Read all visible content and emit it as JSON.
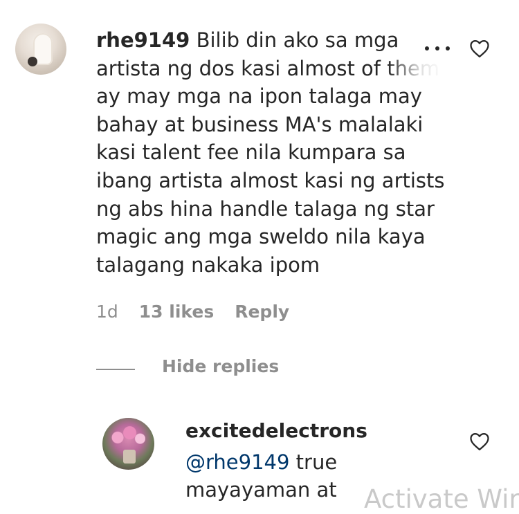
{
  "comment": {
    "username": "rhe9149",
    "text_first_line": "Bilib din ako sa mga",
    "text_rest": "artista ng dos kasi almost of them\nay may mga na ipon talaga may\nbahay at business MA's malalaki\nkasi talent fee nila kumpara sa\nibang artista almost kasi ng artists\nng abs hina handle talaga ng star\nmagic ang mga sweldo nila kaya\ntalagang nakaka ipom",
    "timestamp": "1d",
    "likes": "13 likes",
    "reply_label": "Reply",
    "more_icon": "more-options-icon",
    "like_icon": "heart-icon"
  },
  "replies_toggle": {
    "label": "Hide replies"
  },
  "reply": {
    "username": "excitedelectrons",
    "mention": "@rhe9149",
    "text_after_mention": " true",
    "text_rest": "mayayaman at",
    "like_icon": "heart-icon"
  },
  "watermark": {
    "text": "Activate Wir"
  },
  "colors": {
    "text": "#262626",
    "secondary": "#8e8e8e",
    "mention": "#00376b"
  }
}
